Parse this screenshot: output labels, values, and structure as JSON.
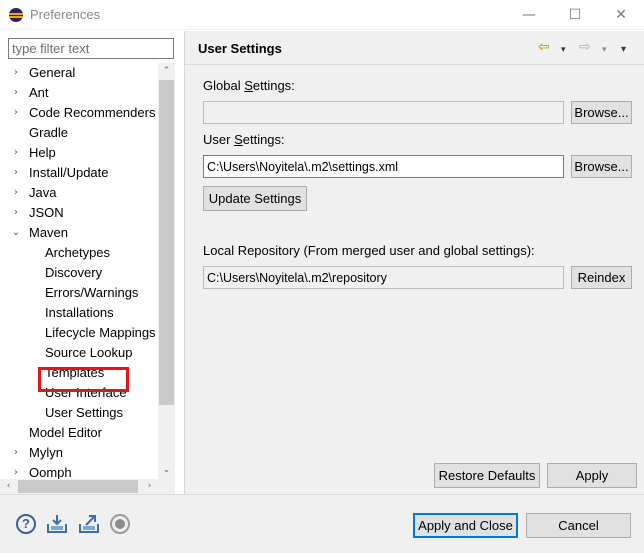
{
  "window": {
    "title": "Preferences",
    "minimize_glyph": "—",
    "maximize_glyph": "☐",
    "close_glyph": "✕"
  },
  "sidebar": {
    "filter_placeholder": "type filter text",
    "items": [
      {
        "label": "General",
        "expander": "›"
      },
      {
        "label": "Ant",
        "expander": "›"
      },
      {
        "label": "Code Recommenders",
        "expander": "›"
      },
      {
        "label": "Gradle",
        "expander": ""
      },
      {
        "label": "Help",
        "expander": "›"
      },
      {
        "label": "Install/Update",
        "expander": "›"
      },
      {
        "label": "Java",
        "expander": "›"
      },
      {
        "label": "JSON",
        "expander": "›"
      },
      {
        "label": "Maven",
        "expander": "⌄"
      },
      {
        "label": "Archetypes",
        "expander": ""
      },
      {
        "label": "Discovery",
        "expander": ""
      },
      {
        "label": "Errors/Warnings",
        "expander": ""
      },
      {
        "label": "Installations",
        "expander": ""
      },
      {
        "label": "Lifecycle Mappings",
        "expander": ""
      },
      {
        "label": "Source Lookup",
        "expander": ""
      },
      {
        "label": "Templates",
        "expander": ""
      },
      {
        "label": "User Interface",
        "expander": ""
      },
      {
        "label": "User Settings",
        "expander": ""
      },
      {
        "label": "Model Editor",
        "expander": ""
      },
      {
        "label": "Mylyn",
        "expander": "›"
      },
      {
        "label": "Oomph",
        "expander": "›"
      }
    ],
    "selected_item": "User Settings",
    "highlight_color": "#e3141c",
    "scroll_up": "⌃",
    "scroll_down": "⌄",
    "scroll_left": "‹",
    "scroll_right": "›"
  },
  "page": {
    "title": "User Settings",
    "nav_back_icon": "⇦",
    "nav_fwd_icon": "⇨",
    "menu_glyph": "▾",
    "global_settings_label_pre": "Global ",
    "global_settings_label_mnemonic": "S",
    "global_settings_label_post": "ettings:",
    "global_settings_value": "",
    "global_browse": "Browse...",
    "user_settings_label_pre": "User ",
    "user_settings_label_mnemonic": "S",
    "user_settings_label_post": "ettings:",
    "user_settings_value": "C:\\Users\\Noyitela\\.m2\\settings.xml",
    "user_browse": "Browse...",
    "update_settings": "Update Settings",
    "local_repo_label": "Local Repository (From merged user and global settings):",
    "local_repo_value": "C:\\Users\\Noyitela\\.m2\\repository",
    "reindex": "Reindex",
    "restore_defaults": "Restore Defaults",
    "apply": "Apply"
  },
  "footer": {
    "help_glyph": "?",
    "apply_and_close": "Apply and Close",
    "cancel": "Cancel"
  },
  "colors": {
    "accent_blue": "#0078d7",
    "nav_back_yellow": "#d8a200"
  }
}
